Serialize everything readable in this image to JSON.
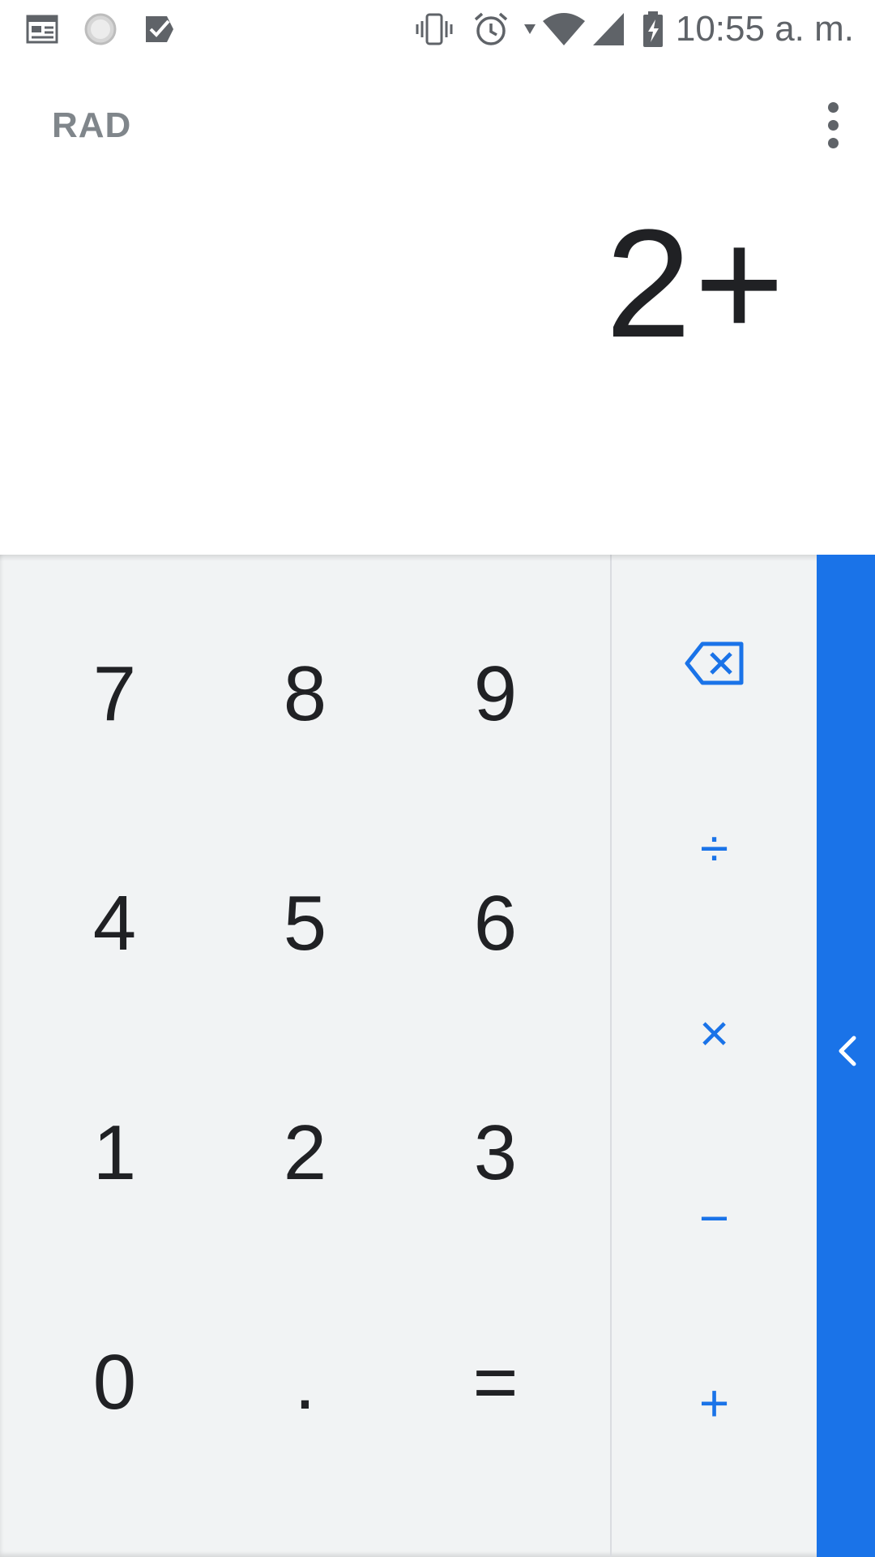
{
  "status_bar": {
    "time": "10:55 a. m.",
    "left_icons": [
      "calendar-icon",
      "loading-icon",
      "task-check-icon"
    ],
    "right_icons": [
      "vibrate-icon",
      "alarm-icon",
      "wifi-icon",
      "signal-icon",
      "battery-charging-icon"
    ]
  },
  "display": {
    "mode": "RAD",
    "expression": "2+",
    "menu_icon": "more-vert-icon"
  },
  "keypad": {
    "digits": [
      [
        "7",
        "8",
        "9"
      ],
      [
        "4",
        "5",
        "6"
      ],
      [
        "1",
        "2",
        "3"
      ],
      [
        "0",
        ".",
        "="
      ]
    ],
    "operators": {
      "delete_icon": "backspace-icon",
      "divide": "÷",
      "multiply": "×",
      "subtract": "−",
      "add": "+"
    },
    "drawer_icon": "chevron-left-icon"
  },
  "colors": {
    "accent": "#1a73e8",
    "keypad_bg": "#f1f3f4",
    "text_primary": "#202124",
    "text_secondary": "#80868b"
  }
}
